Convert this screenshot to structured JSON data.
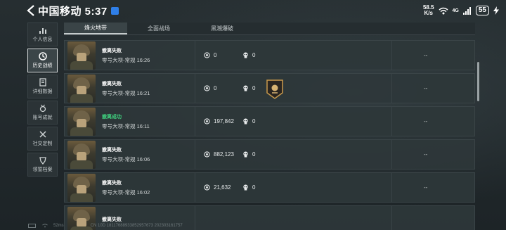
{
  "status_bar": {
    "carrier_time": "中国移动 5:37",
    "net_speed_value": "58.5",
    "net_speed_unit": "K/s",
    "network_type": "4G",
    "battery": "55"
  },
  "sidebar": {
    "items": [
      {
        "label": "个人信息",
        "icon": "bar-chart-icon",
        "active": false
      },
      {
        "label": "历史战绩",
        "icon": "clock-icon",
        "active": true
      },
      {
        "label": "详细数据",
        "icon": "document-icon",
        "active": false
      },
      {
        "label": "账号成就",
        "icon": "medal-icon",
        "active": false
      },
      {
        "label": "社交定制",
        "icon": "tools-icon",
        "active": false
      },
      {
        "label": "领誓档案",
        "icon": "shield-icon",
        "active": false
      }
    ]
  },
  "tabs": [
    {
      "label": "烽火地带",
      "active": true
    },
    {
      "label": "全面战场",
      "active": false
    },
    {
      "label": "黑潮爆破",
      "active": false
    }
  ],
  "records": [
    {
      "result": "撤离失败",
      "success": false,
      "map": "零号大坝-常规 16:26",
      "value": "0",
      "kills": "0",
      "badge": false,
      "extra": "--"
    },
    {
      "result": "撤离失败",
      "success": false,
      "map": "零号大坝-常规 16:21",
      "value": "0",
      "kills": "0",
      "badge": true,
      "extra": "--"
    },
    {
      "result": "撤离成功",
      "success": true,
      "map": "零号大坝-常规 16:11",
      "value": "197,842",
      "kills": "0",
      "badge": false,
      "extra": "--"
    },
    {
      "result": "撤离失败",
      "success": false,
      "map": "零号大坝-常规 16:06",
      "value": "882,123",
      "kills": "0",
      "badge": false,
      "extra": "--"
    },
    {
      "result": "撤离失败",
      "success": false,
      "map": "零号大坝-常规 16:02",
      "value": "21,632",
      "kills": "0",
      "badge": false,
      "extra": "--"
    },
    {
      "result": "撤离失败",
      "success": false,
      "map": "",
      "value": "",
      "kills": "",
      "badge": false,
      "extra": ""
    }
  ],
  "bottom": {
    "ping": "52ms",
    "id_text": "CN 10D 18117688933852957673 202303161757"
  },
  "colors": {
    "success": "#3fd07e",
    "accent_battery": "#ffffff"
  }
}
